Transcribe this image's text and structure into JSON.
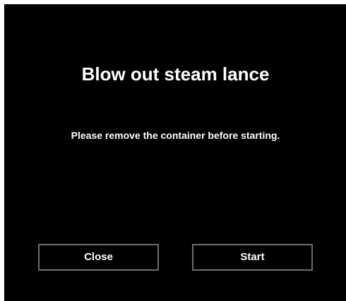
{
  "dialog": {
    "title": "Blow out steam lance",
    "message": "Please remove the container before starting.",
    "close_label": "Close",
    "start_label": "Start"
  },
  "colors": {
    "background": "#000000",
    "text": "#ffffff",
    "button_border": "#6e6e6e"
  }
}
